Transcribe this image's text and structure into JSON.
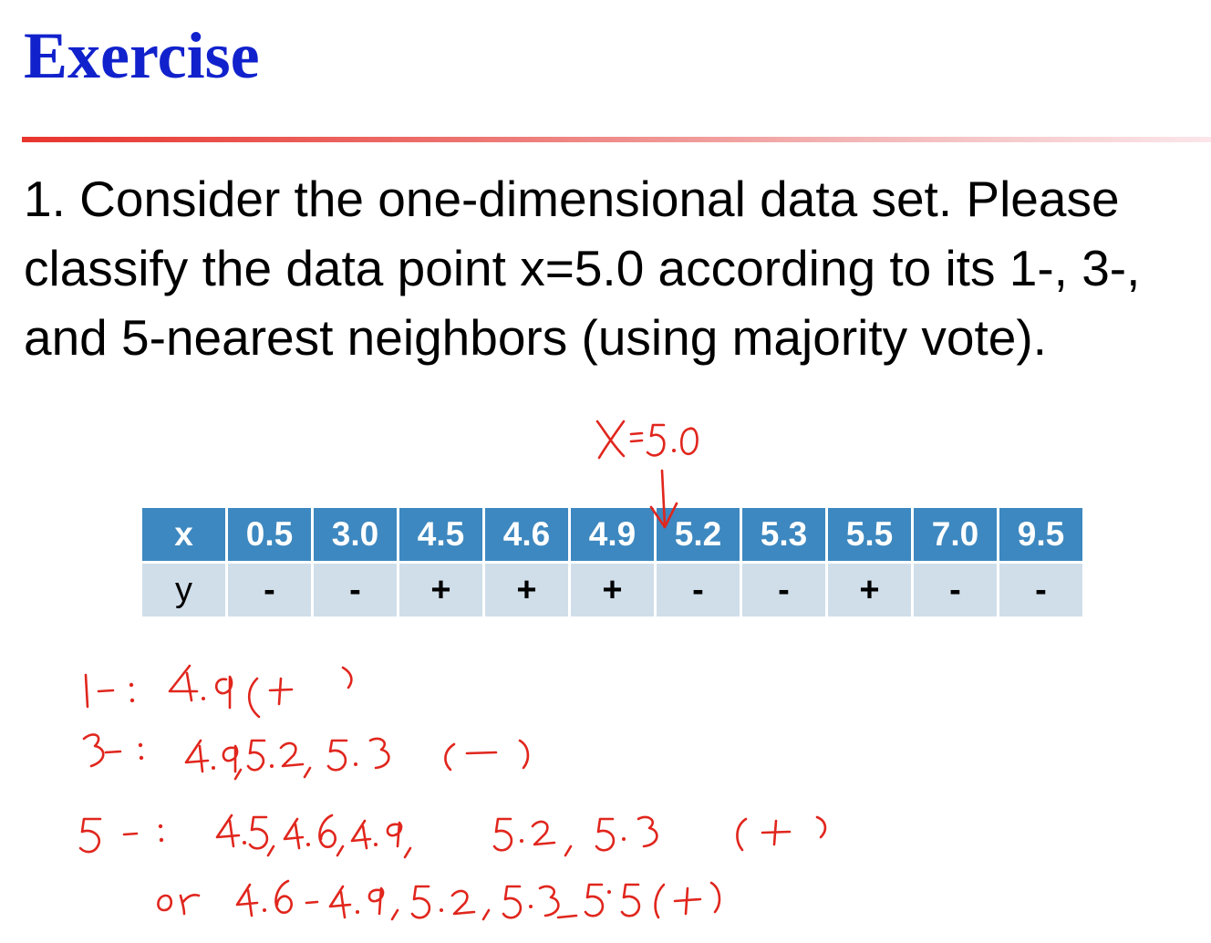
{
  "title": "Exercise",
  "question": "1. Consider the one-dimensional data set. Please classify the data point x=5.0 according to its 1-, 3-, and 5-nearest neighbors (using majority vote).",
  "table": {
    "x_header": "x",
    "y_header": "y",
    "x_values": [
      "0.5",
      "3.0",
      "4.5",
      "4.6",
      "4.9",
      "5.2",
      "5.3",
      "5.5",
      "7.0",
      "9.5"
    ],
    "y_values": [
      "-",
      "-",
      "+",
      "+",
      "+",
      "-",
      "-",
      "+",
      "-",
      "-"
    ]
  },
  "colors": {
    "title": "#1122cc",
    "header_row": "#3d88c0",
    "label_row": "#d0deea",
    "annotation": "#e0261d"
  },
  "handwritten_notes": [
    "x=5.0",
    "1-: 4.9 (+)",
    "3-: 4.9, 5.2, 5.3 (−)",
    "5-: 4.5, 4.6, 4.9, 5.2, 5.3 (+)",
    "or 4.6, 4.9, 5.2, 5.3, 5.5 (+)"
  ]
}
